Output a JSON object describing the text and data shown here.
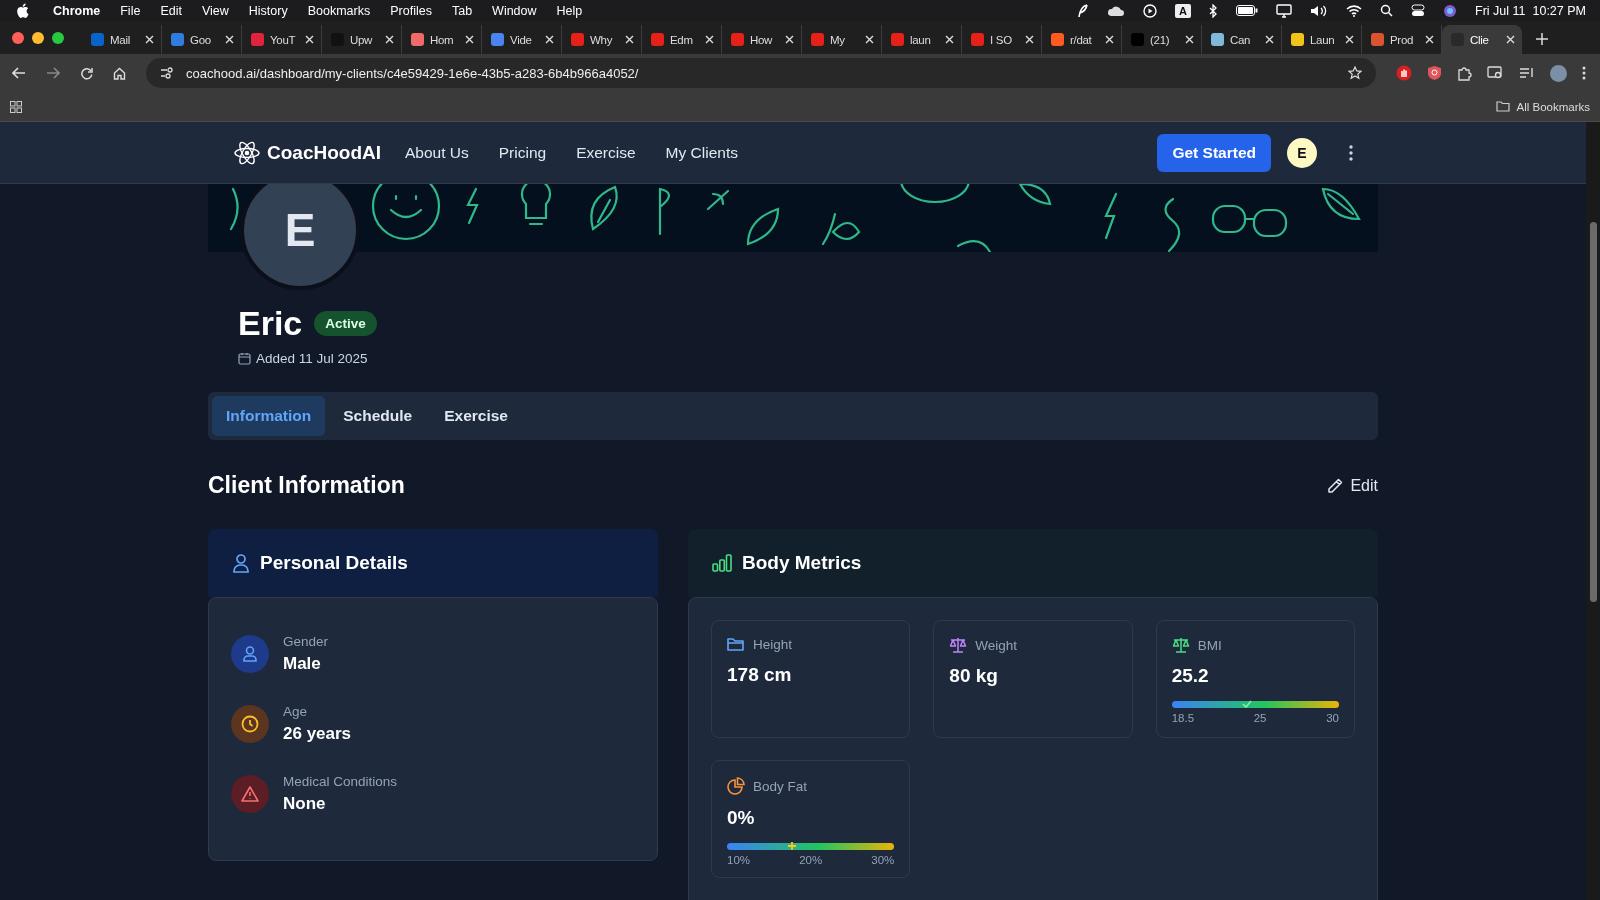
{
  "menu_bar": {
    "app": "Chrome",
    "items": [
      "File",
      "Edit",
      "View",
      "History",
      "Bookmarks",
      "Profiles",
      "Tab",
      "Window",
      "Help"
    ],
    "input_source": "A",
    "clock": "Fri Jul 11  10:27 PM"
  },
  "browser_tabs": [
    {
      "title": "Mail",
      "color": "#0a64c8",
      "selected": false
    },
    {
      "title": "Goo",
      "color": "#2f7de1",
      "selected": false
    },
    {
      "title": "YouT",
      "color": "#e0243b",
      "selected": false
    },
    {
      "title": "Upw",
      "color": "#111111",
      "selected": false
    },
    {
      "title": "Hom",
      "color": "#f06a6a",
      "selected": false
    },
    {
      "title": "Vide",
      "color": "#4a84f0",
      "selected": false
    },
    {
      "title": "Why",
      "color": "#e62117",
      "selected": false
    },
    {
      "title": "Edm",
      "color": "#e62117",
      "selected": false
    },
    {
      "title": "How",
      "color": "#e62117",
      "selected": false
    },
    {
      "title": "My",
      "color": "#e62117",
      "selected": false
    },
    {
      "title": "laun",
      "color": "#e62117",
      "selected": false
    },
    {
      "title": "I SO",
      "color": "#e62117",
      "selected": false
    },
    {
      "title": "r/dat",
      "color": "#ff5a1f",
      "selected": false
    },
    {
      "title": "(21)",
      "color": "#000000",
      "selected": false
    },
    {
      "title": "Can",
      "color": "#7fb8d8",
      "selected": false
    },
    {
      "title": "Laun",
      "color": "#f0c419",
      "selected": false
    },
    {
      "title": "Prod",
      "color": "#da552f",
      "selected": false
    },
    {
      "title": "Clie",
      "color": "#2a2a2a",
      "selected": true
    }
  ],
  "address_bar": {
    "url": "coachood.ai/dashboard/my-clients/c4e59429-1e6e-43b5-a283-6b4b966a4052/"
  },
  "bookmarks_bar": {
    "folder": "All Bookmarks"
  },
  "site_header": {
    "logo": "CoacHoodAI",
    "nav": [
      "About Us",
      "Pricing",
      "Exercise",
      "My Clients"
    ],
    "cta": "Get Started",
    "user_initial": "E"
  },
  "profile": {
    "initial": "E",
    "name": "Eric",
    "status": "Active",
    "added": "Added 11 Jul 2025"
  },
  "tabs": [
    {
      "label": "Information",
      "selected": true
    },
    {
      "label": "Schedule",
      "selected": false
    },
    {
      "label": "Exercise",
      "selected": false
    }
  ],
  "section": {
    "title": "Client Information",
    "edit": "Edit"
  },
  "personal_details": {
    "title": "Personal Details",
    "fields": [
      {
        "kind": "gender",
        "label": "Gender",
        "value": "Male"
      },
      {
        "kind": "age",
        "label": "Age",
        "value": "26 years"
      },
      {
        "kind": "medical",
        "label": "Medical Conditions",
        "value": "None"
      }
    ]
  },
  "body_metrics": {
    "title": "Body Metrics",
    "metrics": [
      {
        "kind": "plain",
        "label": "Height",
        "value": "178 cm"
      },
      {
        "kind": "plain",
        "label": "Weight",
        "value": "80 kg"
      },
      {
        "kind": "scale",
        "label": "BMI",
        "value": "25.2",
        "level": 0.45,
        "ticks": [
          "18.5",
          "25",
          "30"
        ]
      },
      {
        "kind": "scale",
        "label": "Body Fat",
        "value": "0%",
        "level": 0.39,
        "ticks": [
          "10%",
          "20%",
          "30%"
        ]
      }
    ]
  }
}
